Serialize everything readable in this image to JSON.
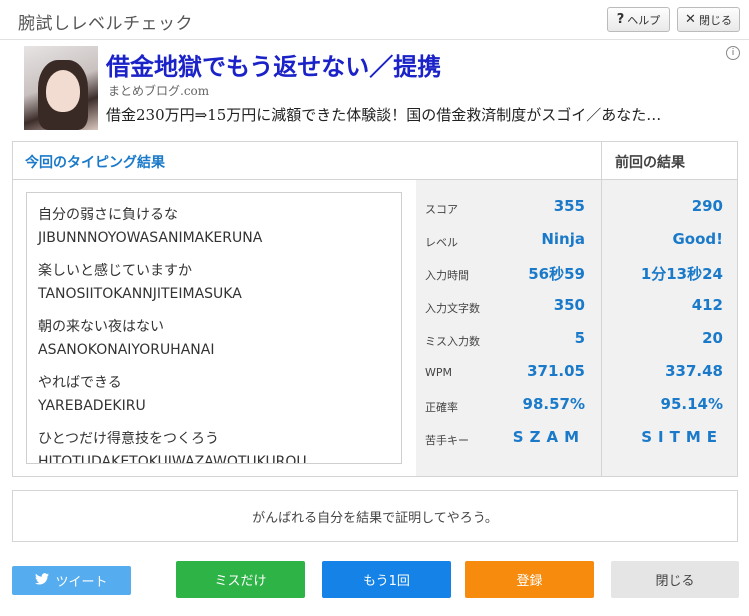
{
  "window": {
    "title": "腕試しレベルチェック",
    "help_label": "ヘルプ",
    "help_icon": "?",
    "close_label": "閉じる",
    "close_icon": "✕"
  },
  "ad": {
    "title": "借金地獄でもう返せない／提携",
    "source": "まとめブログ.com",
    "description": "借金230万円⇒15万円に減額できた体験談！国の借金救済制度がスゴイ／あなた…",
    "info_icon": "⓵"
  },
  "results": {
    "current_heading": "今回のタイピング結果",
    "previous_heading": "前回の結果",
    "typed_items": [
      {
        "jp": "自分の弱さに負けるな",
        "roma": "JIBUNNNOYOWASANIMAKERUNA"
      },
      {
        "jp": "楽しいと感じていますか",
        "roma": "TANOSIITOKANNJITEIMASUKA"
      },
      {
        "jp": "朝の来ない夜はない",
        "roma": "ASANOKONAIYORUHANAI"
      },
      {
        "jp": "やればできる",
        "roma": "YAREBADEKIRU"
      },
      {
        "jp": "ひとつだけ得意技をつくろう",
        "roma": "HITOTUDAKETOKUIWAZAWOTUKUROU"
      }
    ],
    "stats": [
      {
        "label": "スコア",
        "current": "355",
        "previous": "290"
      },
      {
        "label": "レベル",
        "current": "Ninja",
        "previous": "Good!"
      },
      {
        "label": "入力時間",
        "current": "56秒59",
        "previous": "1分13秒24"
      },
      {
        "label": "入力文字数",
        "current": "350",
        "previous": "412"
      },
      {
        "label": "ミス入力数",
        "current": "5",
        "previous": "20"
      },
      {
        "label": "WPM",
        "current": "371.05",
        "previous": "337.48"
      },
      {
        "label": "正確率",
        "current": "98.57%",
        "previous": "95.14%"
      },
      {
        "label": "苦手キー",
        "current": "SZAM",
        "previous": "SITME"
      }
    ]
  },
  "message": "がんばれる自分を結果で証明してやろう。",
  "buttons": {
    "tweet": "ツイート",
    "miss_only": "ミスだけ",
    "retry": "もう1回",
    "register": "登録",
    "close": "閉じる"
  },
  "colors": {
    "accent_blue": "#1a7ac9",
    "tweet": "#55acee",
    "miss_only": "#2eb347",
    "retry": "#1482e6",
    "register": "#f68b0d",
    "close": "#e5e5e5"
  }
}
